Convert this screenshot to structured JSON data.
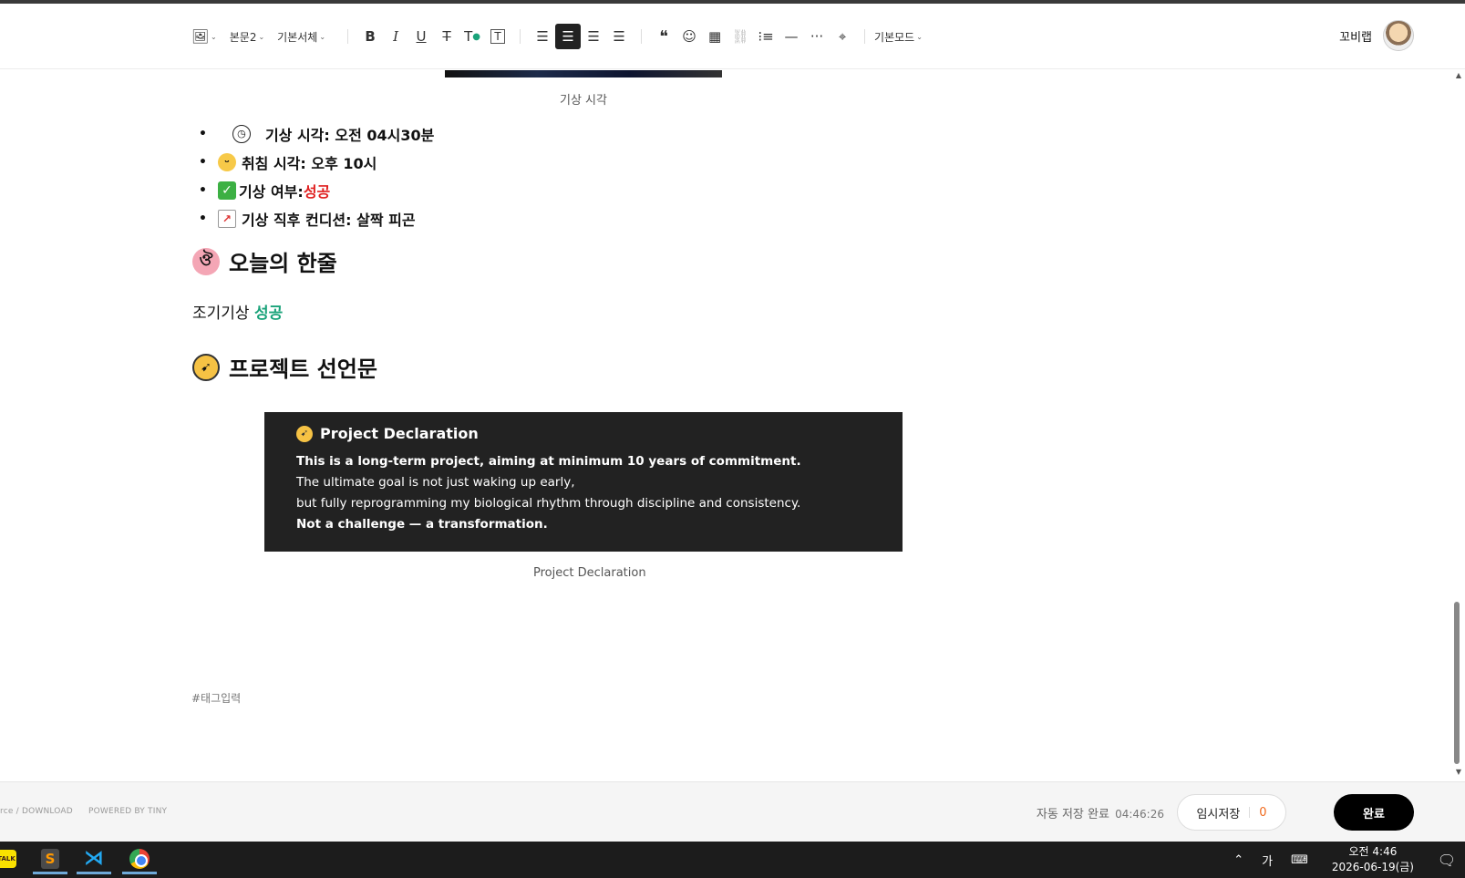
{
  "toolbar": {
    "paragraph_style": "본문2",
    "font_family": "기본서체",
    "mode": "기본모드",
    "user_name": "꼬비랩",
    "icons": [
      "image-icon",
      "bold-icon",
      "italic-icon",
      "underline-icon",
      "strikethrough-icon",
      "text-color-icon",
      "text-background-icon",
      "align-left-icon",
      "align-center-icon",
      "align-right-icon",
      "align-justify-icon",
      "quote-icon",
      "emoji-icon",
      "table-icon",
      "link-icon",
      "list-icon",
      "divider-icon",
      "more-icon",
      "location-icon"
    ]
  },
  "content": {
    "image_caption": "기상 시각",
    "bullets": [
      {
        "label": "기상 시각: 오전 04시30분",
        "icon": "clock-icon"
      },
      {
        "label": "취침 시각: 오후 10시",
        "icon": "sleeping-face-icon"
      },
      {
        "label": "기상 여부: ",
        "value": "성공",
        "icon": "check-mark-icon"
      },
      {
        "label": "기상 직후 컨디션: 살짝 피곤",
        "icon": "chart-icon"
      }
    ],
    "heading1": "오늘의 한줄",
    "paragraph_prefix": "조기기상 ",
    "paragraph_highlight": "성공",
    "heading2": "프로젝트 선언문",
    "declaration": {
      "title": "Project Declaration",
      "line1": "This is a long-term project, aiming at minimum 10 years of commitment.",
      "line2": "The ultimate goal is not just waking up early,",
      "line3": "but fully reprogramming my biological rhythm through discipline and consistency.",
      "line4": "Not a challenge — a transformation."
    },
    "declaration_caption": "Project Declaration",
    "tag_placeholder": "#태그입력"
  },
  "footer": {
    "credit1": "rce / DOWNLOAD",
    "credit2": "POWERED BY TINY",
    "autosave_label": "자동 저장 완료",
    "autosave_time": "04:46:26",
    "temp_save_label": "임시저장",
    "temp_save_count": "0",
    "done_label": "완료"
  },
  "taskbar": {
    "ime": "가",
    "time": "오전 4:46",
    "date": "2026-06-19(금)"
  },
  "colors": {
    "accent_green": "#1aa37a",
    "accent_red": "#e02020",
    "count_orange": "#f06a1d"
  }
}
